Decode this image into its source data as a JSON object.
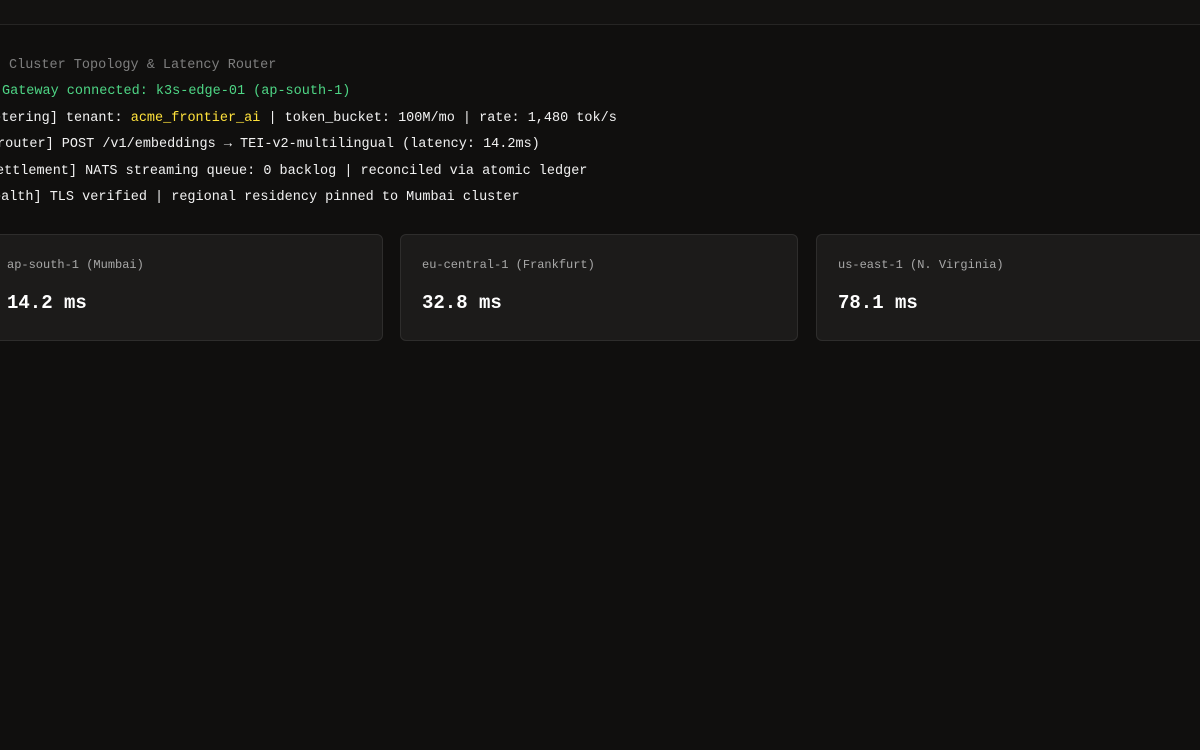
{
  "console": {
    "title": "Cluster Topology & Latency Router",
    "connection": "Gateway connected: k3s-edge-01 (ap-south-1)",
    "metering": {
      "prefix": "etering] tenant: ",
      "tenant": "acme_frontier_ai",
      "suffix": " | token_bucket: 100M/mo | rate: 1,480 tok/s"
    },
    "router": "router] POST /v1/embeddings → TEI-v2-multilingual (latency: 14.2ms)",
    "settlement": "ettlement] NATS streaming queue: 0 backlog | reconciled via atomic ledger",
    "health": "ealth] TLS verified | regional residency pinned to Mumbai cluster"
  },
  "regions": [
    {
      "name": "ap-south-1 (Mumbai)",
      "latency": "14.2 ms"
    },
    {
      "name": "eu-central-1 (Frankfurt)",
      "latency": "32.8 ms"
    },
    {
      "name": "us-east-1 (N. Virginia)",
      "latency": "78.1 ms"
    }
  ],
  "colors": {
    "background": "#100f0e",
    "success": "#4ed685",
    "highlight": "#ffe23b",
    "card": "#1c1b1a"
  }
}
